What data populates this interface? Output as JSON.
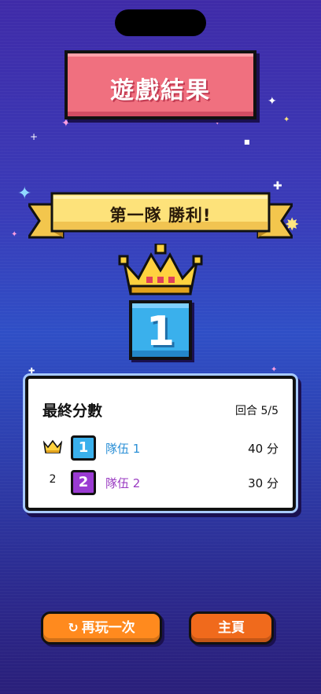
{
  "title": "遊戲結果",
  "banner": "第一隊 勝利!",
  "winner_rank": "1",
  "scoreboard": {
    "heading": "最終分數",
    "round_label": "回合 5/5",
    "rows": [
      {
        "rank_icon": "crown-icon",
        "badge": "1",
        "name": "隊伍 1",
        "score": "40 分",
        "color": "#2a8fd6",
        "badge_color": "#3ab0ec"
      },
      {
        "rank": "2",
        "badge": "2",
        "name": "隊伍 2",
        "score": "30 分",
        "color": "#9a3bc2",
        "badge_color": "#9a3bd2"
      }
    ]
  },
  "buttons": {
    "replay": "再玩一次",
    "home": "主頁"
  },
  "colors": {
    "title_red": "#f0707f",
    "ribbon_gold": "#fde27a",
    "orange": "#ff8a1e"
  }
}
